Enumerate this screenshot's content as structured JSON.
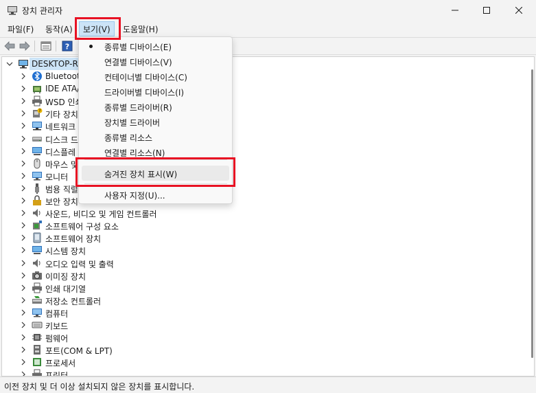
{
  "window": {
    "title": "장치 관리자",
    "controls": {
      "minimize": "minimize-icon",
      "maximize": "maximize-icon",
      "close": "close-icon"
    }
  },
  "menubar": {
    "file": "파일(F)",
    "action": "동작(A)",
    "view": "보기(V)",
    "help": "도움말(H)"
  },
  "toolbar": {
    "icons": [
      "back-arrow-icon",
      "forward-arrow-icon",
      "properties-icon",
      "help-icon"
    ]
  },
  "tree": {
    "root": "DESKTOP-RN",
    "items": [
      {
        "label": "Bluetooth",
        "icon": "bluetooth-icon"
      },
      {
        "label": "IDE ATA/",
        "icon": "ide-controller-icon"
      },
      {
        "label": "WSD 인쇄",
        "icon": "printer-icon"
      },
      {
        "label": "기타 장치",
        "icon": "other-device-icon"
      },
      {
        "label": "네트워크",
        "icon": "network-icon"
      },
      {
        "label": "디스크 드",
        "icon": "disk-drive-icon"
      },
      {
        "label": "디스플레",
        "icon": "display-adapter-icon"
      },
      {
        "label": "마우스 및",
        "icon": "mouse-icon"
      },
      {
        "label": "모니터",
        "icon": "monitor-icon"
      },
      {
        "label": "범용 직렬",
        "icon": "usb-icon"
      },
      {
        "label": "보안 장치",
        "icon": "security-device-icon"
      },
      {
        "label": "사운드, 비디오 및 게임 컨트롤러",
        "icon": "sound-icon"
      },
      {
        "label": "소프트웨어 구성 요소",
        "icon": "software-component-icon"
      },
      {
        "label": "소프트웨어 장치",
        "icon": "software-device-icon"
      },
      {
        "label": "시스템 장치",
        "icon": "system-device-icon"
      },
      {
        "label": "오디오 입력 및 출력",
        "icon": "audio-icon"
      },
      {
        "label": "이미징 장치",
        "icon": "imaging-device-icon"
      },
      {
        "label": "인쇄 대기열",
        "icon": "print-queue-icon"
      },
      {
        "label": "저장소 컨트롤러",
        "icon": "storage-controller-icon"
      },
      {
        "label": "컴퓨터",
        "icon": "computer-icon"
      },
      {
        "label": "키보드",
        "icon": "keyboard-icon"
      },
      {
        "label": "펌웨어",
        "icon": "firmware-icon"
      },
      {
        "label": "포트(COM & LPT)",
        "icon": "port-icon"
      },
      {
        "label": "프로세서",
        "icon": "processor-icon"
      },
      {
        "label": "프린터",
        "icon": "printer-icon"
      }
    ]
  },
  "view_menu": {
    "items": [
      {
        "label": "종류별 디바이스(E)",
        "checked": true
      },
      {
        "label": "연결별 디바이스(V)",
        "checked": false
      },
      {
        "label": "컨테이너별 디바이스(C)",
        "checked": false
      },
      {
        "label": "드라이버별 디바이스(I)",
        "checked": false
      },
      {
        "label": "종류별 드라이버(R)",
        "checked": false
      },
      {
        "label": "장치별 드라이버",
        "checked": false
      },
      {
        "label": "종류별 리소스",
        "checked": false
      },
      {
        "label": "연결별 리소스(N)",
        "checked": false
      }
    ],
    "show_hidden": "숨겨진 장치 표시(W)",
    "customize": "사용자 지정(U)..."
  },
  "statusbar": {
    "text": "이전 장치 및 더 이상 설치되지 않은 장치를 표시합니다."
  },
  "colors": {
    "highlight_red": "#e81123",
    "menu_selected": "#cce4f7",
    "tree_selected": "#cce4f7"
  }
}
